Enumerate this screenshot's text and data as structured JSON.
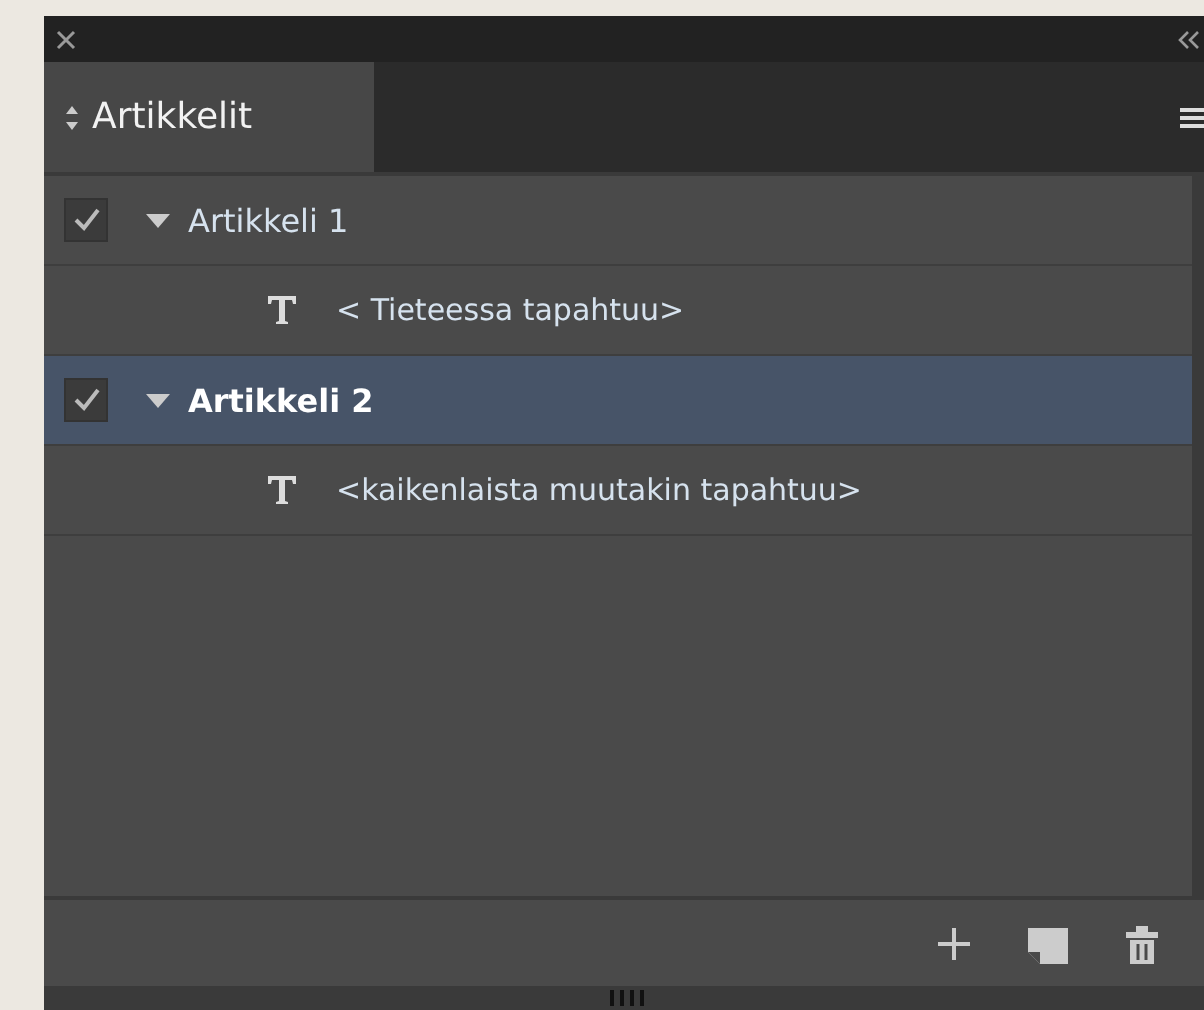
{
  "panel": {
    "tab": {
      "label": "Artikkelit",
      "selected": true
    }
  },
  "articles": [
    {
      "title": "Artikkeli 1",
      "checked": true,
      "expanded": true,
      "selected": false,
      "children": [
        {
          "kind": "text",
          "label": "< Tieteessa tapahtuu>"
        }
      ]
    },
    {
      "title": "Artikkeli 2",
      "checked": true,
      "expanded": true,
      "selected": true,
      "children": [
        {
          "kind": "text",
          "label": "<kaikenlaista muutakin tapahtuu>"
        }
      ]
    }
  ]
}
